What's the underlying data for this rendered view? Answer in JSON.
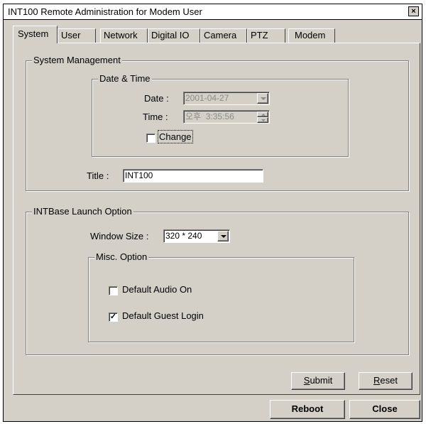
{
  "window": {
    "title": "INT100 Remote Administration for Modem User",
    "close_glyph": "×"
  },
  "tabs": [
    {
      "label": "System",
      "active": true
    },
    {
      "label": "User"
    },
    {
      "label": "Network"
    },
    {
      "label": "Digital IO"
    },
    {
      "label": "Camera"
    },
    {
      "label": "PTZ"
    },
    {
      "label": "Modem"
    }
  ],
  "system_management": {
    "legend": "System Management",
    "date_time": {
      "legend": "Date & Time",
      "date_label": "Date :",
      "date_value": "2001-04-27",
      "time_label": "Time :",
      "time_value": "오후  3:35:56",
      "change_label": "Change",
      "change_checked": false
    },
    "title_label": "Title :",
    "title_value": "INT100"
  },
  "launch_option": {
    "legend": "INTBase Launch Option",
    "window_size_label": "Window Size :",
    "window_size_value": "320 * 240",
    "misc": {
      "legend": "Misc. Option",
      "audio_label": "Default Audio On",
      "audio_checked": false,
      "guest_label": "Default Guest Login",
      "guest_checked": true
    }
  },
  "buttons": {
    "submit_first": "S",
    "submit_rest": "ubmit",
    "reset_first": "R",
    "reset_rest": "eset",
    "reboot": "Reboot",
    "close": "Close"
  },
  "check_glyph": "✓"
}
